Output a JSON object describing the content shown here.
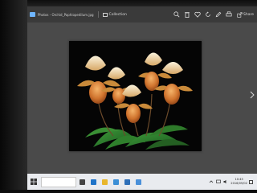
{
  "titlebar": {
    "app_name": "Photos - Orchid_Paphiopedilum.jpg",
    "collection_label": "Collection",
    "share_label": "Share"
  },
  "toolbar_icons": [
    "zoom-icon",
    "delete-icon",
    "favorite-icon",
    "rotate-icon",
    "edit-icon",
    "print-icon",
    "share-icon"
  ],
  "photo": {
    "subject": "orchid-flowers-on-black"
  },
  "taskbar": {
    "apps": [
      {
        "name": "task-view",
        "color": "#444444"
      },
      {
        "name": "edge",
        "color": "#1e73c8"
      },
      {
        "name": "file-explorer",
        "color": "#e8b62c"
      },
      {
        "name": "store",
        "color": "#3c8fd6"
      },
      {
        "name": "mail",
        "color": "#2e6fb8"
      },
      {
        "name": "photos",
        "color": "#4a90d9"
      }
    ],
    "time": "10:45",
    "date": "2016/09/02"
  },
  "colors": {
    "titlebar": "#3a3a3a",
    "photo_background": "#4a4a4a",
    "taskbar": "#e9ebef",
    "accent": "#6fb5ff"
  }
}
